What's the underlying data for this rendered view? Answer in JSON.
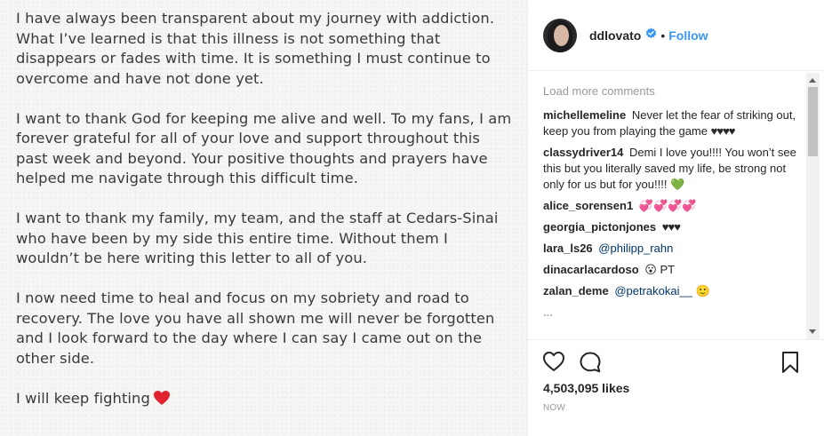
{
  "letter": {
    "paragraphs": [
      "I have always been transparent about my journey with addiction. What I’ve learned is that this illness is not something that disappears or fades with time.  It is something I must continue to overcome and have not done yet.",
      "I want to thank God for keeping me alive and well. To my fans, I am forever grateful for all of your love and support throughout this past week and beyond. Your positive thoughts and prayers have helped me navigate through this difficult time.",
      "I want to thank my family, my team, and the staff at Cedars-Sinai who have been by my side this entire time. Without them I wouldn’t be here writing this letter to all of you.",
      "I now need time to heal and focus on my sobriety and road to recovery. The love you have all shown me will never be forgotten and I look forward to the day where I can say I came out on the other side."
    ],
    "closing": "I will keep fighting"
  },
  "header": {
    "username": "ddlovato",
    "separator": "•",
    "follow_label": "Follow"
  },
  "comments": {
    "load_more": "Load more comments",
    "items": [
      {
        "author": "michellemeline",
        "text": "Never let the fear of striking out, keep you from playing the game",
        "suffix": "♥♥♥♥"
      },
      {
        "author": "classydriver14",
        "text": "Demi I love you!!!! You won’t see this but you literally saved my life, be strong not only for us but for you!!!!",
        "suffix": "💚"
      },
      {
        "author": "alice_sorensen1",
        "text": "💞💞💞💞",
        "suffix": ""
      },
      {
        "author": "georgia_pictonjones",
        "text": "♥♥♥",
        "suffix": ""
      },
      {
        "author": "lara_ls26",
        "mention": "@philipp_rahn",
        "text": "",
        "suffix": ""
      },
      {
        "author": "dinacarlacardoso",
        "text": "😮 PT",
        "suffix": ""
      },
      {
        "author": "zalan_deme",
        "mention": "@petrakokai__",
        "text": "🙂",
        "suffix": ""
      },
      {
        "author": "...",
        "text": "",
        "suffix": ""
      }
    ]
  },
  "post": {
    "likes": "4,503,095 likes",
    "time": "NOW"
  },
  "colors": {
    "link": "#3897f0",
    "text": "#262626",
    "muted": "#999999",
    "heart": "#e0232e"
  }
}
